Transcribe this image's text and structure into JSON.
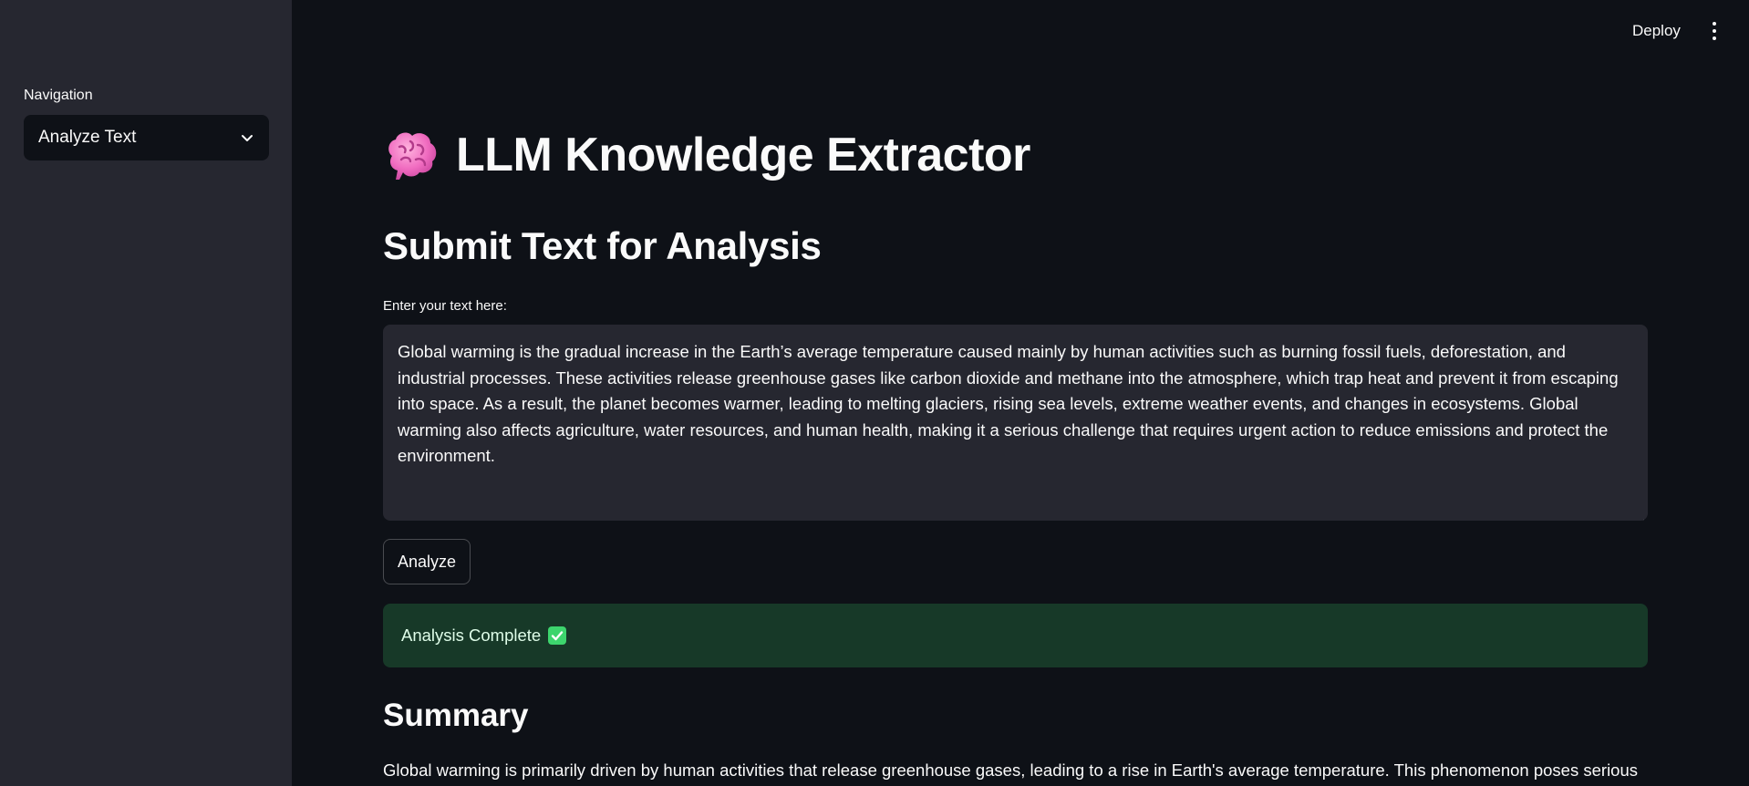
{
  "header": {
    "deploy_label": "Deploy",
    "menu_icon": "kebab-menu-icon"
  },
  "sidebar": {
    "nav_label": "Navigation",
    "selected_page": "Analyze Text"
  },
  "main": {
    "app_title": "LLM Knowledge Extractor",
    "title_icon": "brain-emoji",
    "section_title": "Submit Text for Analysis",
    "input_label": "Enter your text here:",
    "input_value": "Global warming is the gradual increase in the Earth’s average temperature caused mainly by human activities such as burning fossil fuels, deforestation, and industrial processes. These activities release greenhouse gases like carbon dioxide and methane into the atmosphere, which trap heat and prevent it from escaping into space. As a result, the planet becomes warmer, leading to melting glaciers, rising sea levels, extreme weather events, and changes in ecosystems. Global warming also affects agriculture, water resources, and human health, making it a serious challenge that requires urgent action to reduce emissions and protect the environment.",
    "analyze_label": "Analyze",
    "success_message": "Analysis Complete",
    "success_icon": "check-mark-emoji",
    "summary_title": "Summary",
    "summary_text": "Global warming is primarily driven by human activities that release greenhouse gases, leading to a rise in Earth's average temperature. This phenomenon poses serious"
  },
  "colors": {
    "background": "#0e1117",
    "sidebar": "#262730",
    "success_bg": "#173928",
    "success_text": "#dffde9",
    "check_green": "#3dd56d"
  }
}
